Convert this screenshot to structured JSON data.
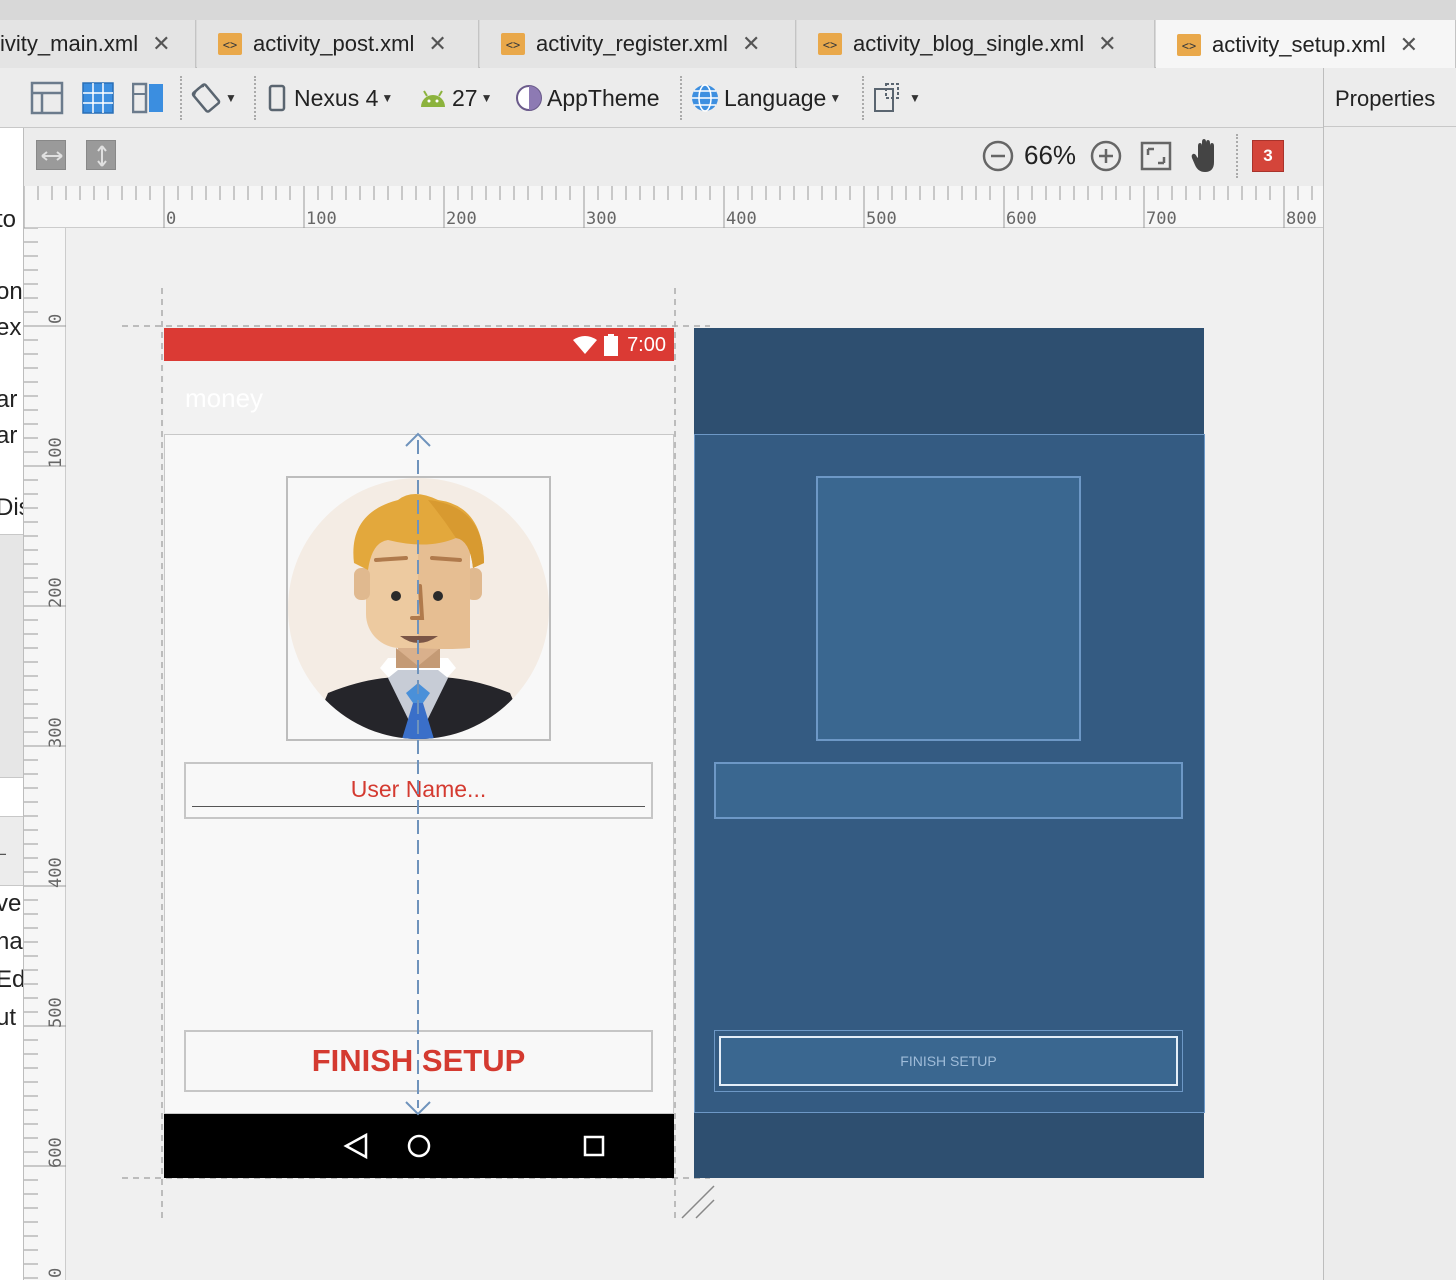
{
  "tabs": [
    {
      "label": "ivity_main.xml",
      "active": false
    },
    {
      "label": "activity_post.xml",
      "active": false
    },
    {
      "label": "activity_register.xml",
      "active": false
    },
    {
      "label": "activity_blog_single.xml",
      "active": false
    },
    {
      "label": "activity_setup.xml",
      "active": true
    }
  ],
  "toolbar": {
    "device": "Nexus 4",
    "api": "27",
    "theme": "AppTheme",
    "language": "Language"
  },
  "properties_title": "Properties",
  "zoom": "66%",
  "error_count": "3",
  "left_panel_fragments": [
    "to",
    "on",
    "ex",
    "ar",
    "ar",
    "Dis",
    "vel",
    "na",
    "Ed",
    "ut"
  ],
  "rulers": {
    "horizontal": [
      "0",
      "100",
      "200",
      "300",
      "400",
      "500",
      "600",
      "700",
      "800"
    ],
    "vertical": [
      "0",
      "100",
      "200",
      "300",
      "400",
      "500",
      "600",
      "0"
    ]
  },
  "phone": {
    "status_time": "7:00",
    "app_title": "money",
    "name_field_text": "User Name...",
    "finish_button": "FINISH SETUP"
  },
  "blueprint": {
    "finish_button": "FINISH SETUP"
  },
  "colors": {
    "accent": "#d43a30",
    "status_bar": "#db3a34",
    "blueprint_bg": "#2e4f70",
    "blueprint_panel": "#345b82"
  }
}
